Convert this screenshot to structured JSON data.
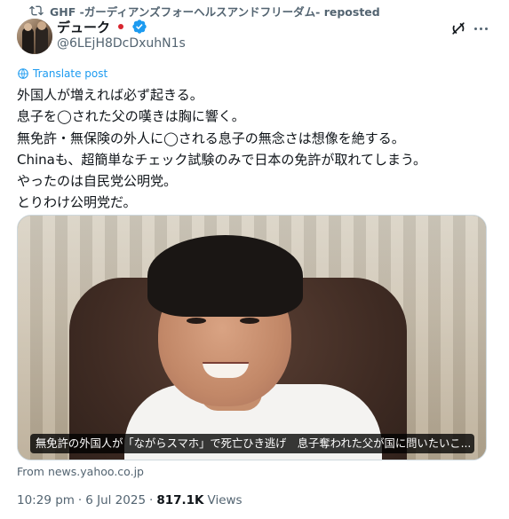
{
  "repost": {
    "icon": "repost-icon",
    "text": "GHF -ガーディアンズフォーヘルスアンドフリーダム- reposted"
  },
  "author": {
    "display_name": "デューク",
    "handle": "@6LEjH8DcDxuhN1s",
    "verified": true,
    "flag": "japan-flag-icon"
  },
  "actions": {
    "grok_icon": "grok-icon",
    "more_icon": "more-icon"
  },
  "translate_label": "Translate post",
  "tweet_lines": [
    "外国人が増えれば必ず起きる。",
    "息子を◯された父の嘆きは胸に響く。",
    "無免許・無保険の外人に◯される息子の無念さは想像を絶する。",
    "Chinaも、超簡単なチェック試験のみで日本の免許が取れてしまう。",
    "やったのは自民党公明党。",
    "とりわけ公明党だ。"
  ],
  "media": {
    "caption": "無免許の外国人が「ながらスマホ」で死亡ひき逃げ　息子奪われた父が国に問いたいこ..."
  },
  "link_source": "From news.yahoo.co.jp",
  "meta": {
    "time": "10:29 pm",
    "separator1": "·",
    "date": "6 Jul 2025",
    "separator2": "·",
    "views_count": "817.1K",
    "views_label": "Views"
  },
  "colors": {
    "link_blue": "#1d9bf0",
    "secondary_text": "#536471",
    "primary_text": "#0f1419",
    "flag_red": "#d8262f"
  }
}
